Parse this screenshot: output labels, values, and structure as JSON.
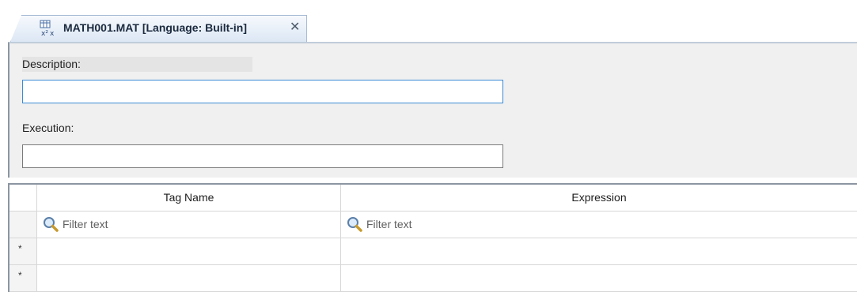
{
  "tab": {
    "title": "MATH001.MAT [Language: Built-in]",
    "icon": "math-routine-icon",
    "close": "✕"
  },
  "panel": {
    "description_label": "Description:",
    "description_value": "",
    "execution_label": "Execution:",
    "execution_value": ""
  },
  "grid": {
    "columns": [
      "Tag Name",
      "Expression"
    ],
    "filter_placeholder": "Filter text",
    "rows": [
      {
        "marker": "*",
        "tag_name": "",
        "expression": ""
      },
      {
        "marker": "*",
        "tag_name": "",
        "expression": ""
      }
    ]
  },
  "colors": {
    "tab_border": "#a7bcd6",
    "focus_border": "#3a8bd6",
    "panel_bg": "#f0f0f0"
  }
}
